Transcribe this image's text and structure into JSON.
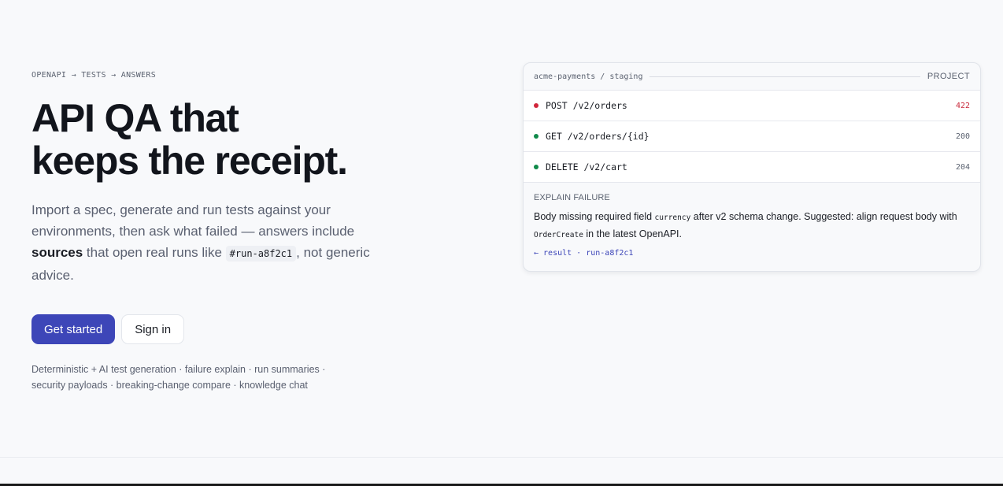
{
  "hero": {
    "eyebrow": "OPENAPI → TESTS → ANSWERS",
    "headline_line1": "API QA that",
    "headline_line2": "keeps the receipt.",
    "lede_part1": "Import a spec, generate and run tests against your environments, then ask what failed — answers include ",
    "lede_bold": "sources",
    "lede_part2": " that open real runs like ",
    "lede_code": "#run-a8f2c1",
    "lede_part3": ", not generic advice.",
    "primary_cta": "Get started",
    "secondary_cta": "Sign in",
    "features_line1": "Deterministic + AI test generation · failure explain · run summaries ·",
    "features_line2": "security payloads · breaking-change compare · knowledge chat"
  },
  "card": {
    "project_path": "acme-payments / staging",
    "project_label": "PROJECT",
    "endpoints": [
      {
        "label": "POST /v2/orders",
        "status": "422",
        "dot_color": "#d1263b",
        "status_color": "#c8283a"
      },
      {
        "label": "GET /v2/orders/{id}",
        "status": "200",
        "dot_color": "#108a4a",
        "status_color": "#5b6270"
      },
      {
        "label": "DELETE /v2/cart",
        "status": "204",
        "dot_color": "#108a4a",
        "status_color": "#5b6270"
      }
    ],
    "explain": {
      "title": "EXPLAIN FAILURE",
      "body_part1": "Body missing required field ",
      "body_code1": "currency",
      "body_part2": " after v2 schema change. Suggested: align request body with ",
      "body_code2": "OrderCreate",
      "body_part3": " in the latest OpenAPI.",
      "link": "← result · run-a8f2c1"
    }
  }
}
